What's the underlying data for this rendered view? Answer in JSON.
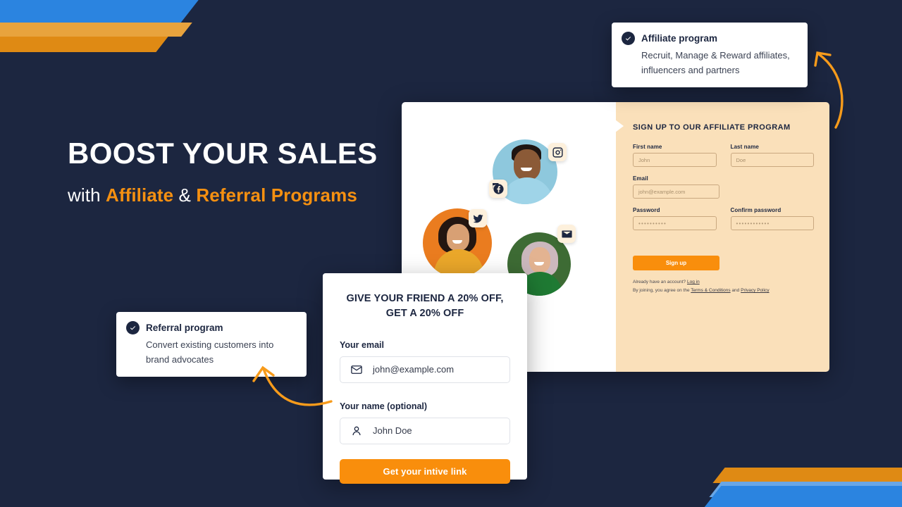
{
  "theme": {
    "background": "#1c2640",
    "accent_orange": "#f59011",
    "button_orange": "#f98e0c",
    "blue": "#2b84e0",
    "cream": "#fae0ba",
    "navy_text": "#1c2640"
  },
  "hero": {
    "headline": "BOOST YOUR SALES",
    "sub_with": "with ",
    "sub_affiliate": "Affiliate",
    "sub_amp": " & ",
    "sub_referral": "Referral Programs"
  },
  "callouts": [
    {
      "id": "affiliate",
      "icon": "check-circle-icon",
      "title": "Affiliate program",
      "body": "Recruit, Manage & Reward affiliates, influencers and partners"
    },
    {
      "id": "referral",
      "icon": "check-circle-icon",
      "title": "Referral program",
      "body": "Convert existing customers into brand advocates"
    }
  ],
  "signup_panel": {
    "title": "SIGN UP TO OUR AFFILIATE PROGRAM",
    "fields": [
      {
        "label": "First name",
        "value": "John"
      },
      {
        "label": "Last name",
        "value": "Doe"
      },
      {
        "label": "Email",
        "value": "john@example.com"
      },
      {
        "label": "Password",
        "value": "••••••••••"
      },
      {
        "label": "Confirm password",
        "value": "••••••••••••"
      }
    ],
    "submit_label": "Sign up",
    "legal_line1_text": "Already have an account? ",
    "legal_line1_link": "Log in",
    "legal_line2_prefix": "By joining, you agree on the ",
    "legal_line2_link1": "Terms & Conditions",
    "legal_line2_middle": " and ",
    "legal_line2_link2": "Privacy Policy"
  },
  "referral_card": {
    "title_line1": "GIVE YOUR FRIEND A 20% OFF,",
    "title_line2": "GET A 20% OFF",
    "email_label": "Your email",
    "email_value": "john@example.com",
    "email_icon": "envelope-icon",
    "name_label": "Your name (optional)",
    "name_value": "John Doe",
    "name_icon": "user-icon",
    "submit_label": "Get your intive link"
  },
  "social_badges": [
    {
      "name": "instagram-icon"
    },
    {
      "name": "facebook-icon"
    },
    {
      "name": "twitter-icon"
    },
    {
      "name": "email-icon"
    }
  ],
  "portraits": [
    {
      "name": "portrait-man",
      "bg": "#8ec8dd"
    },
    {
      "name": "portrait-woman-orange",
      "bg": "#ea7c1f"
    },
    {
      "name": "portrait-woman-green",
      "bg": "#3d6b34"
    }
  ]
}
